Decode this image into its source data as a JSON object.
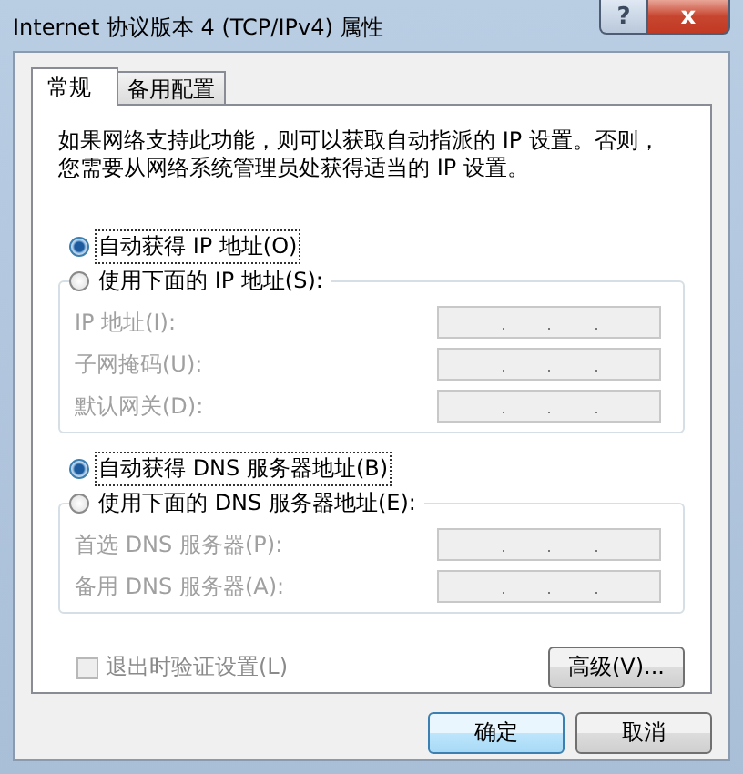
{
  "window": {
    "title": "Internet 协议版本 4 (TCP/IPv4) 属性",
    "help": "?",
    "close": "x"
  },
  "tabs": [
    {
      "label": "常规",
      "selected": true
    },
    {
      "label": "备用配置",
      "selected": false
    }
  ],
  "description": "如果网络支持此功能，则可以获取自动指派的 IP 设置。否则，您需要从网络系统管理员处获得适当的 IP 设置。",
  "ip": {
    "auto": {
      "label": "自动获得 IP 地址(O)",
      "selected": true
    },
    "manual": {
      "label": "使用下面的 IP 地址(S):",
      "selected": false
    },
    "fields": [
      {
        "label": "IP 地址(I):",
        "disabled": true
      },
      {
        "label": "子网掩码(U):",
        "disabled": true
      },
      {
        "label": "默认网关(D):",
        "disabled": true
      }
    ]
  },
  "dns": {
    "auto": {
      "label": "自动获得 DNS 服务器地址(B)",
      "selected": true
    },
    "manual": {
      "label": "使用下面的 DNS 服务器地址(E):",
      "selected": false
    },
    "fields": [
      {
        "label": "首选 DNS 服务器(P):",
        "disabled": true
      },
      {
        "label": "备用 DNS 服务器(A):",
        "disabled": true
      }
    ]
  },
  "validate": {
    "label": "退出时验证设置(L)",
    "checked": false,
    "disabled": true
  },
  "advanced": "高级(V)...",
  "buttons": [
    "确定",
    "取消"
  ]
}
